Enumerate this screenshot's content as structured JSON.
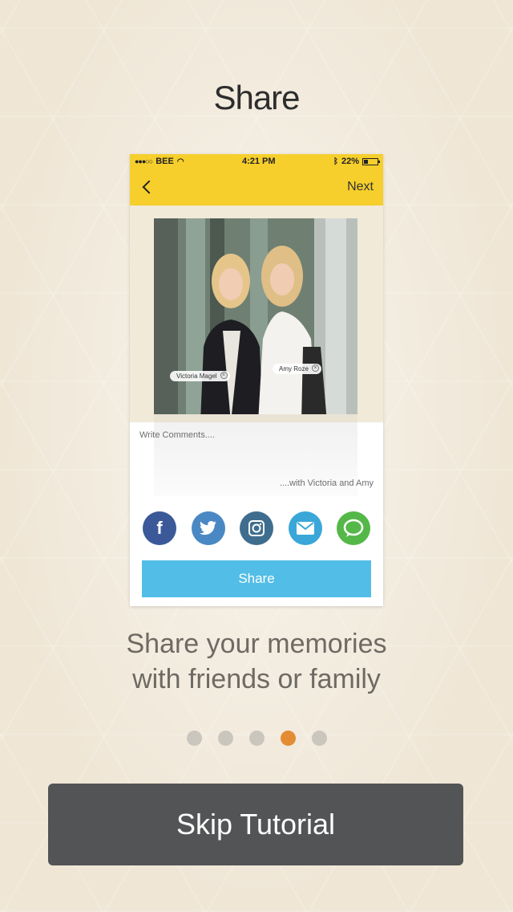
{
  "page": {
    "title": "Share",
    "subtitle_line1": "Share your memories",
    "subtitle_line2": "with friends or family",
    "skip_label": "Skip Tutorial",
    "pagination": {
      "total": 5,
      "active_index": 3
    }
  },
  "mockup": {
    "status": {
      "carrier": "BEE",
      "time": "4:21 PM",
      "battery": "22%"
    },
    "nav": {
      "next_label": "Next"
    },
    "tags": [
      "Victoria Magel",
      "Amy Roze"
    ],
    "comment_placeholder": "Write Comments....",
    "comment_suffix": "....with Victoria and Amy",
    "social": [
      {
        "icon": "facebook-icon",
        "glyph": "f",
        "color": "#3b5998"
      },
      {
        "icon": "twitter-icon",
        "glyph": "t",
        "color": "#4a88c4"
      },
      {
        "icon": "instagram-icon",
        "glyph": "◘",
        "color": "#3f6d8e"
      },
      {
        "icon": "mail-icon",
        "glyph": "✉",
        "color": "#3aa7d8"
      },
      {
        "icon": "message-icon",
        "glyph": "◯",
        "color": "#54b848"
      }
    ],
    "share_label": "Share"
  },
  "colors": {
    "accent_yellow": "#f6cf2c",
    "share_blue": "#52bde6",
    "active_dot": "#e38c33",
    "skip_button": "#535455"
  }
}
